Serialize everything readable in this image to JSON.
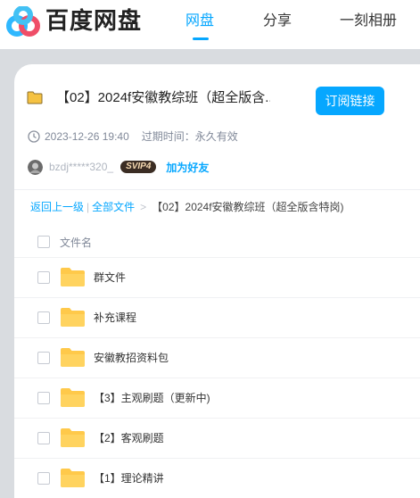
{
  "header": {
    "brand": "百度网盘",
    "nav": [
      "网盘",
      "分享",
      "一刻相册"
    ],
    "active_nav": "网盘"
  },
  "share": {
    "title": "【02】2024f安徽教综班（超全版含...",
    "subscribe_label": "订阅链接",
    "date": "2023-12-26 19:40",
    "expire_label": "过期时间：永久有效",
    "username": "bzdj*****320_",
    "vip_badge": "SVIP4",
    "add_friend_label": "加为好友"
  },
  "breadcrumb": {
    "back": "返回上一级",
    "all_files": "全部文件",
    "current": "【02】2024f安徽教综班（超全版含特岗)"
  },
  "list": {
    "header_label": "文件名",
    "items": [
      {
        "name": "群文件"
      },
      {
        "name": "补充课程"
      },
      {
        "name": "安徽教招资料包"
      },
      {
        "name": "【3】主观刷题（更新中)"
      },
      {
        "name": "【2】客观刷题"
      },
      {
        "name": "【1】理论精讲"
      }
    ]
  },
  "colors": {
    "accent": "#06a7ff",
    "folder": "#ffc94a",
    "background": "#d9dce0"
  }
}
